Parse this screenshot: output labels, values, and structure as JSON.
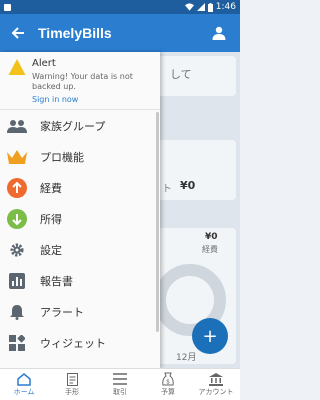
{
  "status_bar": {
    "time": "1:46"
  },
  "app_bar": {
    "title": "TimelyBills"
  },
  "background": {
    "card_text": "して",
    "zero_1": "¥0",
    "total_label": "ト",
    "total_value": "¥0",
    "zero_2": "¥0",
    "expense": "経費",
    "month": "12月",
    "fab": "+"
  },
  "drawer": {
    "alert": {
      "title": "Alert",
      "message": "Warning! Your data is not backed up.",
      "link": "Sign in now"
    },
    "items": [
      {
        "label": "家族グループ",
        "icon": "people-icon"
      },
      {
        "label": "プロ機能",
        "icon": "crown-icon"
      },
      {
        "label": "経費",
        "icon": "expense-up-icon"
      },
      {
        "label": "所得",
        "icon": "income-down-icon"
      },
      {
        "label": "設定",
        "icon": "gear-icon"
      },
      {
        "label": "報告書",
        "icon": "report-chart-icon"
      },
      {
        "label": "アラート",
        "icon": "bell-icon"
      },
      {
        "label": "ウィジェット",
        "icon": "widgets-icon"
      }
    ]
  },
  "bottom_nav": {
    "items": [
      {
        "label": "ホーム",
        "icon": "home-icon"
      },
      {
        "label": "手形",
        "icon": "bill-icon"
      },
      {
        "label": "取引",
        "icon": "transactions-icon"
      },
      {
        "label": "予算",
        "icon": "budget-icon"
      },
      {
        "label": "アカウント",
        "icon": "account-bank-icon"
      }
    ]
  },
  "colors": {
    "primary": "#2b7dd0",
    "status_bar": "#1f5e9e",
    "alert_yellow": "#f2c21b",
    "crown_orange": "#f0a020",
    "expense_orange": "#ef6a2e",
    "income_green": "#7cbd4a"
  }
}
